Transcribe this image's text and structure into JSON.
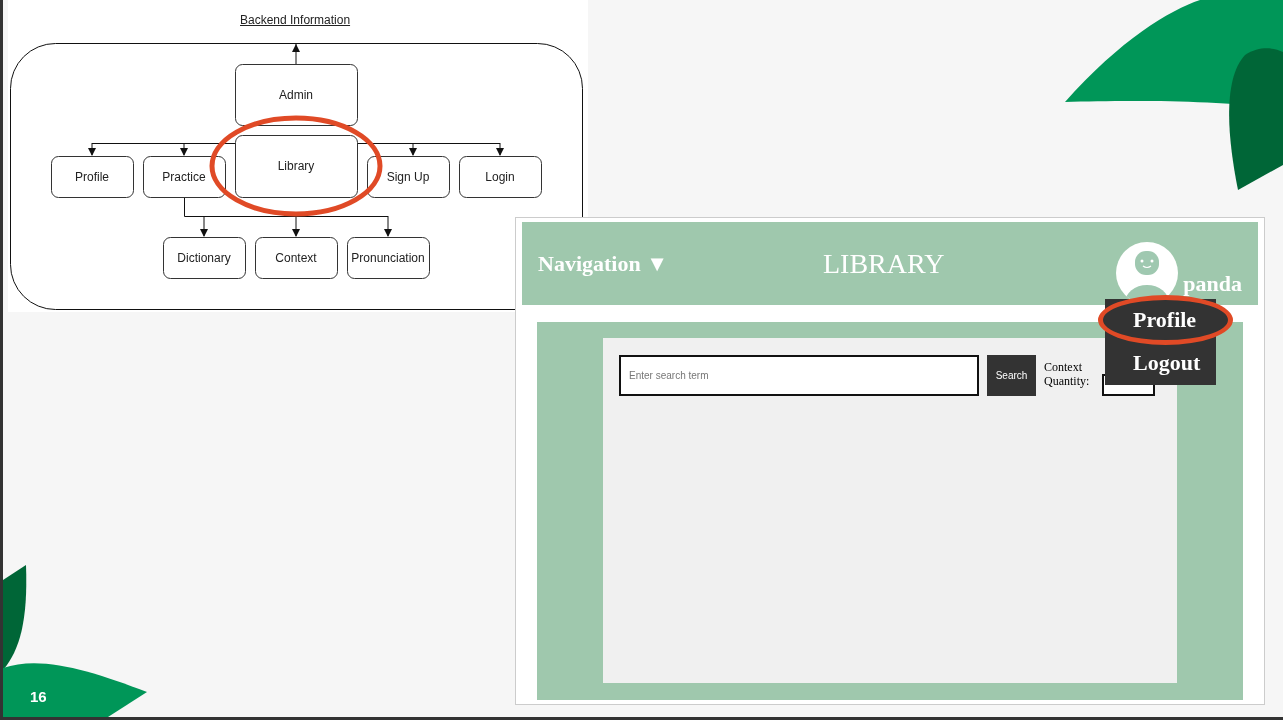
{
  "diagram": {
    "title": "Backend Information",
    "nodes": [
      {
        "label": "Admin",
        "highlighted": false
      },
      {
        "label": "Library",
        "highlighted": true
      },
      {
        "label": "Profile",
        "highlighted": false
      },
      {
        "label": "Practice",
        "highlighted": false
      },
      {
        "label": "Sign Up",
        "highlighted": false
      },
      {
        "label": "Login",
        "highlighted": false
      },
      {
        "label": "Dictionary",
        "highlighted": false
      },
      {
        "label": "Context",
        "highlighted": false
      },
      {
        "label": "Pronunciation",
        "highlighted": false
      }
    ]
  },
  "app": {
    "navigation": "Navigation ▼",
    "title": "LIBRARY",
    "username": "panda",
    "menu": [
      {
        "label": "Profile",
        "highlighted": true
      },
      {
        "label": "Logout",
        "highlighted": false
      }
    ],
    "search": {
      "placeholder": "Enter search term",
      "button": "Search"
    },
    "quantity_label": "Context Quantity:"
  },
  "slide_number": "16"
}
